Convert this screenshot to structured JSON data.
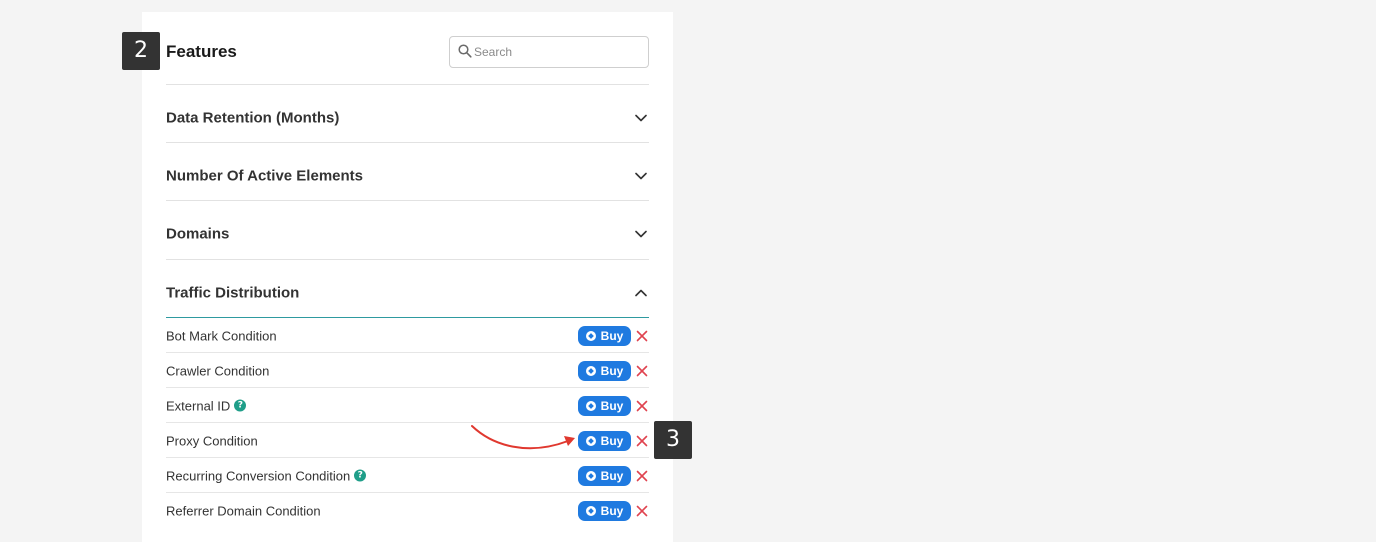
{
  "features": {
    "step_number": "2",
    "title": "Features",
    "search": {
      "placeholder": "Search",
      "value": ""
    },
    "sections": [
      {
        "label": "Data Retention (Months)",
        "state": "collapsed",
        "icon": "chevron-down-icon"
      },
      {
        "label": "Number Of Active Elements",
        "state": "collapsed",
        "icon": "chevron-down-icon"
      },
      {
        "label": "Domains",
        "state": "collapsed",
        "icon": "chevron-down-icon"
      },
      {
        "label": "Traffic Distribution",
        "state": "expanded",
        "icon": "chevron-up-icon"
      }
    ],
    "items": [
      {
        "label": "Bot Mark Condition",
        "help": false,
        "buy_label": "Buy"
      },
      {
        "label": "Crawler Condition",
        "help": false,
        "buy_label": "Buy"
      },
      {
        "label": "External ID",
        "help": true,
        "help_glyph": "?",
        "buy_label": "Buy"
      },
      {
        "label": "Proxy Condition",
        "help": false,
        "buy_label": "Buy"
      },
      {
        "label": "Recurring Conversion Condition",
        "help": true,
        "help_glyph": "?",
        "buy_label": "Buy"
      },
      {
        "label": "Referrer Domain Condition",
        "help": false,
        "buy_label": "Buy"
      }
    ]
  },
  "annotation": {
    "step_number": "3",
    "arrow_color": "#e0382f"
  },
  "colors": {
    "background": "#f4f4f4",
    "panel": "#ffffff",
    "buy_button": "#1f7ae0",
    "remove_icon": "#e0434f",
    "help_icon": "#1f9e89",
    "expanded_underline": "#2e9aa0",
    "step_badge": "#333333"
  }
}
